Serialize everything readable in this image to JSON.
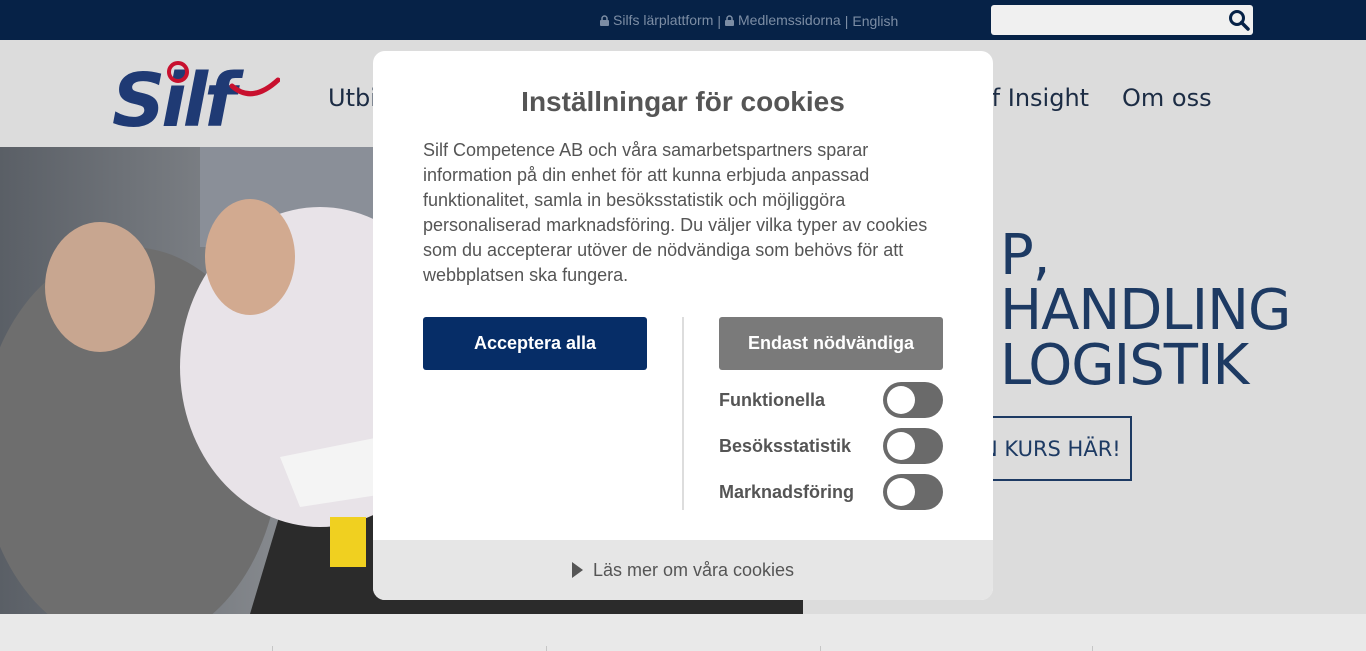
{
  "topbar": {
    "links": [
      {
        "label": "Silfs lärplattform",
        "icon": "lock-icon"
      },
      {
        "label": "Medlemssidorna",
        "icon": "lock-icon"
      },
      {
        "label": "English"
      }
    ],
    "separator": "|",
    "search": {
      "value": "",
      "placeholder": "",
      "icon": "search-icon"
    }
  },
  "header": {
    "logo_text": "Silf",
    "nav": [
      "Utbi",
      "lf Insight",
      "Om oss"
    ]
  },
  "hero": {
    "lines": [
      "P,",
      "HANDLING",
      "LOGISTIK"
    ],
    "cta": "N KURS HÄR!"
  },
  "cookie_modal": {
    "title": "Inställningar för cookies",
    "body": "Silf Competence AB och våra samarbetspartners sparar information på din enhet för att kunna erbjuda anpassad funktionalitet, samla in besöksstatistik och möjliggöra personaliserad marknadsföring. Du väljer vilka typer av cookies som du accepterar utöver de nödvändiga som behövs för att webbplatsen ska fungera.",
    "accept_all": "Acceptera alla",
    "only_necessary": "Endast nödvändiga",
    "options": [
      {
        "label": "Funktionella",
        "enabled": false
      },
      {
        "label": "Besöksstatistik",
        "enabled": false
      },
      {
        "label": "Marknadsföring",
        "enabled": false
      }
    ],
    "read_more": "Läs mer om våra cookies"
  },
  "colors": {
    "topbar": "#062247",
    "brand_blue": "#062d67",
    "brand_red": "#c8102e",
    "toggle_off": "#6a6a6a",
    "button_grey": "#7a7a7a"
  }
}
